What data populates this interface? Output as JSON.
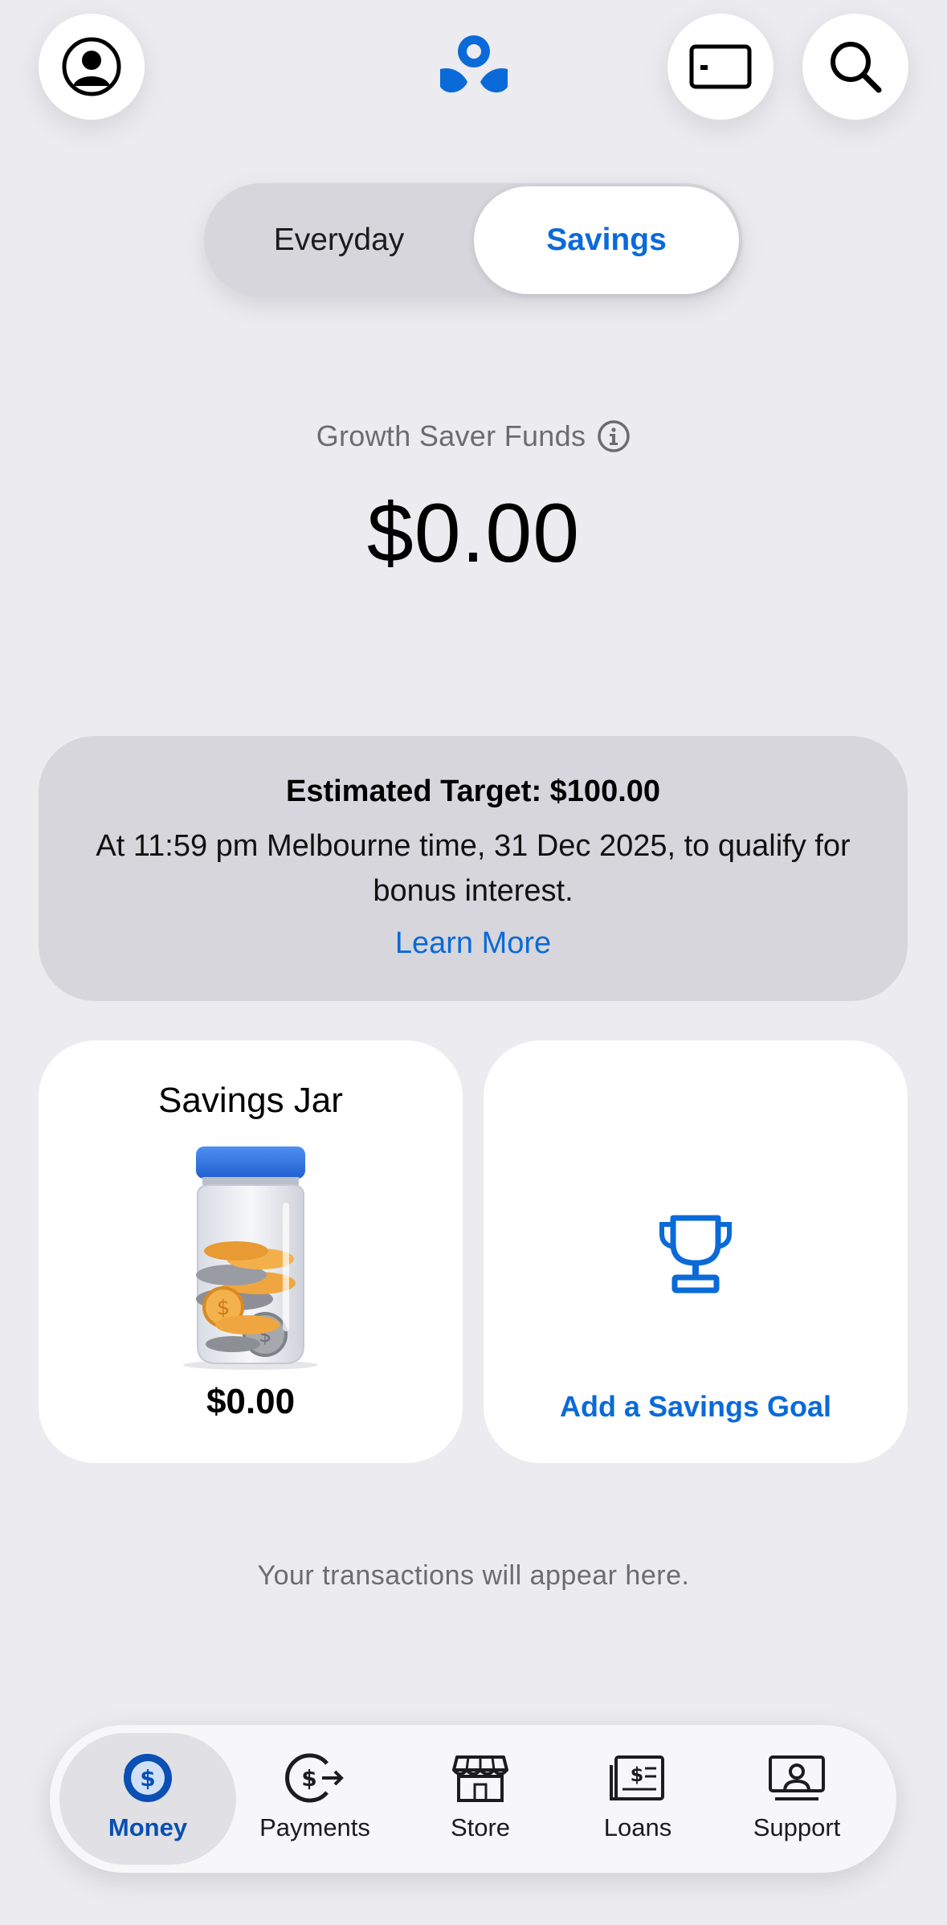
{
  "header": {
    "profile_icon": "person-circle-icon",
    "logo_icon": "ubank-logo-icon",
    "card_icon": "card-icon",
    "search_icon": "search-icon"
  },
  "segmented": {
    "options": [
      "Everyday",
      "Savings"
    ],
    "selected": "Savings"
  },
  "balance": {
    "label": "Growth Saver Funds",
    "amount": "$0.00"
  },
  "target": {
    "title": "Estimated Target: $100.00",
    "description": "At 11:59 pm Melbourne time, 31 Dec 2025, to qualify for bonus interest.",
    "link": "Learn More"
  },
  "tiles": {
    "jar": {
      "title": "Savings Jar",
      "amount": "$0.00"
    },
    "goal": {
      "label": "Add a Savings Goal"
    }
  },
  "empty_state": "Your transactions will appear here.",
  "tabbar": {
    "items": [
      {
        "label": "Money",
        "icon": "dollar-circle-icon",
        "active": true
      },
      {
        "label": "Payments",
        "icon": "payments-icon",
        "active": false
      },
      {
        "label": "Store",
        "icon": "store-icon",
        "active": false
      },
      {
        "label": "Loans",
        "icon": "loans-icon",
        "active": false
      },
      {
        "label": "Support",
        "icon": "support-icon",
        "active": false
      }
    ]
  },
  "colors": {
    "accent": "#0a6ad8",
    "background": "#ebebf0",
    "card_gray": "#d6d6dc"
  }
}
